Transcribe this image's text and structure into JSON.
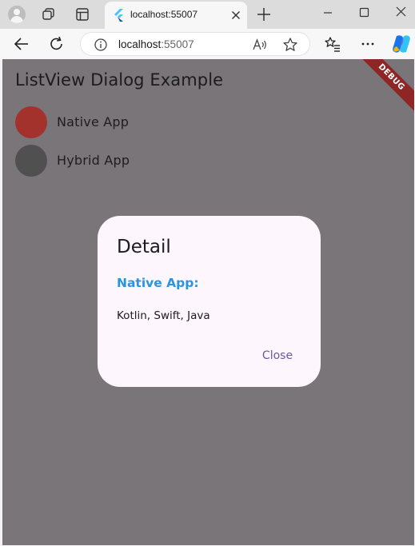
{
  "browser": {
    "tab": {
      "title": "localhost:55007",
      "favicon": "flutter-icon"
    },
    "address": {
      "host": "localhost",
      "port": ":55007"
    },
    "icons": {
      "profile": "profile-icon",
      "workspaces": "workspaces-icon",
      "tab_actions": "vertical-tabs-icon",
      "new_tab": "plus-icon",
      "back": "back-arrow-icon",
      "refresh": "refresh-icon",
      "info": "info-icon",
      "read_aloud": "read-aloud-icon",
      "favorite": "star-icon",
      "favorites": "favorites-icon",
      "more": "more-icon",
      "copilot": "copilot-icon"
    }
  },
  "app": {
    "title": "ListView Dialog Example",
    "debug_banner": "DEBUG",
    "list": [
      {
        "label": "Native App",
        "avatar_color": "#a3322c"
      },
      {
        "label": "Hybrid App",
        "avatar_color": "#505050"
      }
    ],
    "scrim_color": "#7a7579"
  },
  "dialog": {
    "title": "Detail",
    "subtitle": "Native App:",
    "body": "Kotlin, Swift, Java",
    "close_label": "Close",
    "accent_color": "#2a94e0",
    "button_color": "#6a5a9f"
  }
}
